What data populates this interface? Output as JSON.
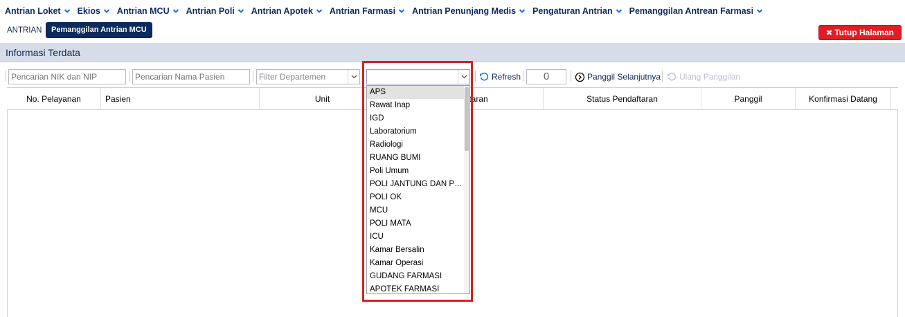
{
  "nav": {
    "items": [
      {
        "label": "Antrian Loket"
      },
      {
        "label": "Ekios"
      },
      {
        "label": "Antrian MCU"
      },
      {
        "label": "Antrian Poli"
      },
      {
        "label": "Antrian Apotek"
      },
      {
        "label": "Antrian Farmasi"
      },
      {
        "label": "Antrian Penunjang Medis"
      },
      {
        "label": "Pengaturan Antrian"
      },
      {
        "label": "Pemanggilan Antrean Farmasi"
      }
    ]
  },
  "subbar": {
    "tab_antrian": "ANTRIAN",
    "tab_mcu": "Pemanggilan Antrian MCU",
    "close_button": "Tutup Halaman"
  },
  "panel": {
    "title": "Informasi Terdata"
  },
  "toolbar": {
    "search_nik_placeholder": "Pencarian NIK dan NIP",
    "search_name_placeholder": "Pencarian Nama Pasien",
    "filter_dept_placeholder": "Filter Departemen",
    "dept_combo_value": "",
    "refresh_label": "Refresh",
    "counter_value": "0",
    "next_label": "Panggil Selanjutnya",
    "recall_label": "Ulang Panggilan"
  },
  "grid": {
    "columns": [
      "No. Pelayanan",
      "Pasien",
      "Unit",
      "ftaran",
      "Status Pendaftaran",
      "Panggil",
      "Konfirmasi Datang"
    ]
  },
  "dropdown": {
    "options": [
      "APS",
      "Rawat Inap",
      "IGD",
      "Laboratorium",
      "Radiologi",
      "RUANG BUMI",
      "Poli Umum",
      "POLI JANTUNG DAN PEMBULUH DARAH",
      "POLI OK",
      "MCU",
      "POLI MATA",
      "ICU",
      "Kamar Bersalin",
      "Kamar Operasi",
      "GUDANG FARMASI",
      "APOTEK FARMASI"
    ],
    "selected_index": 0
  },
  "colors": {
    "navy": "#0d2a5c",
    "danger": "#e31b23",
    "highlight": "#d42126",
    "panel_header_bg": "#d7dde8"
  }
}
